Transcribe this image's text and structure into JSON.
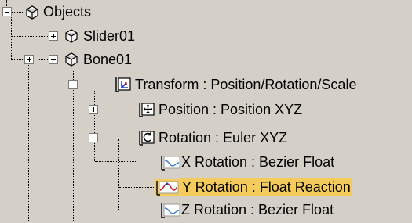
{
  "tree": {
    "root": {
      "label": "Objects",
      "icon": "object-cube-icon",
      "expander": "minus"
    },
    "slider": {
      "label": "Slider01",
      "icon": "object-cube-icon",
      "expander": "plus"
    },
    "bone": {
      "label": "Bone01",
      "icon": "object-cube-icon",
      "expander": "minus",
      "outer_expander": "plus"
    },
    "transform": {
      "label": "Transform : Position/Rotation/Scale",
      "icon": "transform-controller-icon",
      "expander": "minus"
    },
    "position": {
      "label": "Position : Position XYZ",
      "icon": "position-controller-icon",
      "expander": "plus"
    },
    "rotation": {
      "label": "Rotation : Euler XYZ",
      "icon": "rotation-controller-icon",
      "expander": "minus"
    },
    "x_rotation": {
      "label": "X Rotation : Bezier Float",
      "icon": "bezier-curve-icon"
    },
    "y_rotation": {
      "label": "Y Rotation : Float Reaction",
      "icon": "reaction-curve-icon",
      "selected": true
    },
    "z_rotation": {
      "label": "Z Rotation : Bezier Float",
      "icon": "bezier-curve-icon"
    }
  },
  "colors": {
    "background": "#d4d0c8",
    "selection": "#f5cc5c"
  }
}
